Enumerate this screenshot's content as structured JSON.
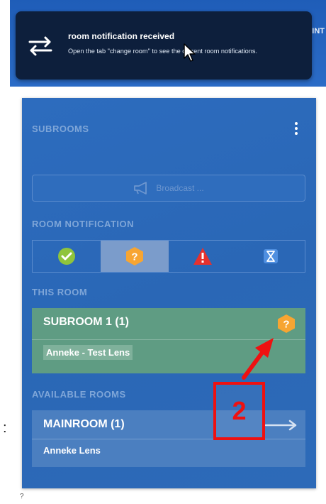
{
  "banner": {
    "edge_text": "INT",
    "toast_title": "room notification received",
    "toast_body": "Open the tab \"change room\" to see the current room notifications."
  },
  "panel": {
    "subrooms_label": "SUBROOMS",
    "broadcast_label": "Broadcast ...",
    "room_notification_label": "ROOM NOTIFICATION",
    "notification_options": [
      "ok",
      "question",
      "alert",
      "waiting"
    ],
    "active_option": "question",
    "this_room_label": "THIS ROOM",
    "this_room": {
      "name": "SUBROOM 1 (1)",
      "member": "Anneke - Test Lens",
      "status": "question"
    },
    "available_rooms_label": "AVAILABLE ROOMS",
    "available_rooms": [
      {
        "name": "MAINROOM (1)",
        "member": "Anneke Lens"
      }
    ]
  },
  "annotation": {
    "number": "2",
    "side_mark": ":",
    "stray_mark": "?"
  },
  "colors": {
    "panel_blue": "#2d6cbe",
    "subroom_green": "#5f9c83",
    "annotation_red": "#ee1111",
    "ok_green": "#8fc43c",
    "question_orange": "#f7a532",
    "alert_red": "#e5312e"
  }
}
